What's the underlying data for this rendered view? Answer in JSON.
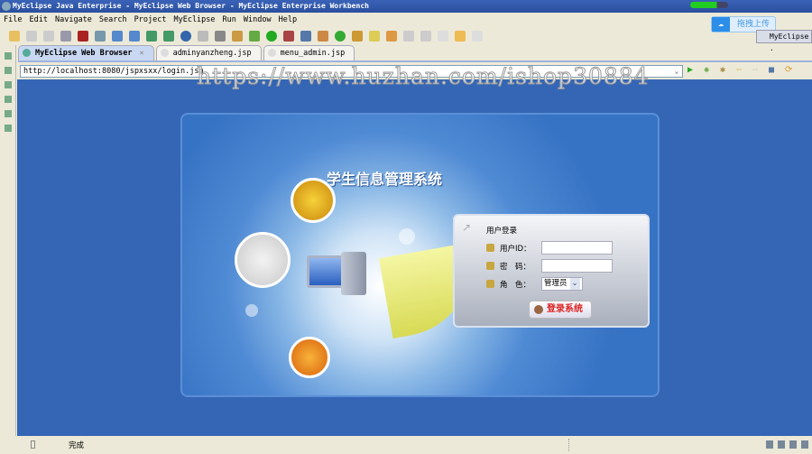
{
  "window": {
    "title": "MyEclipse Java Enterprise - MyEclipse Web Browser - MyEclipse Enterprise Workbench"
  },
  "menu": [
    "File",
    "Edit",
    "Navigate",
    "Search",
    "Project",
    "MyEclipse",
    "Run",
    "Window",
    "Help"
  ],
  "upload_widget": {
    "label": "拖拽上传"
  },
  "perspective": {
    "label": "MyEclipse ."
  },
  "tabs": [
    {
      "label": "MyEclipse Web Browser",
      "active": true
    },
    {
      "label": "adminyanzheng.jsp"
    },
    {
      "label": "menu_admin.jsp"
    }
  ],
  "browser": {
    "url": "http://localhost:8080/jspxsxx/login.jsp"
  },
  "watermark": "https://www.huzhan.com/ishop30884",
  "page": {
    "system_title": "学生信息管理系统",
    "login": {
      "header": "用户登录",
      "user_label": "用户ID：",
      "user_value": "",
      "password_label": "密　码：",
      "password_value": "",
      "role_label": "角　色：",
      "role_value": "管理员",
      "submit": "登录系统"
    }
  },
  "status": {
    "text": "完成"
  },
  "colors": {
    "content_bg": "#3566b5",
    "title_bar": "#2a4f9e",
    "button_text": "#dd2222"
  }
}
